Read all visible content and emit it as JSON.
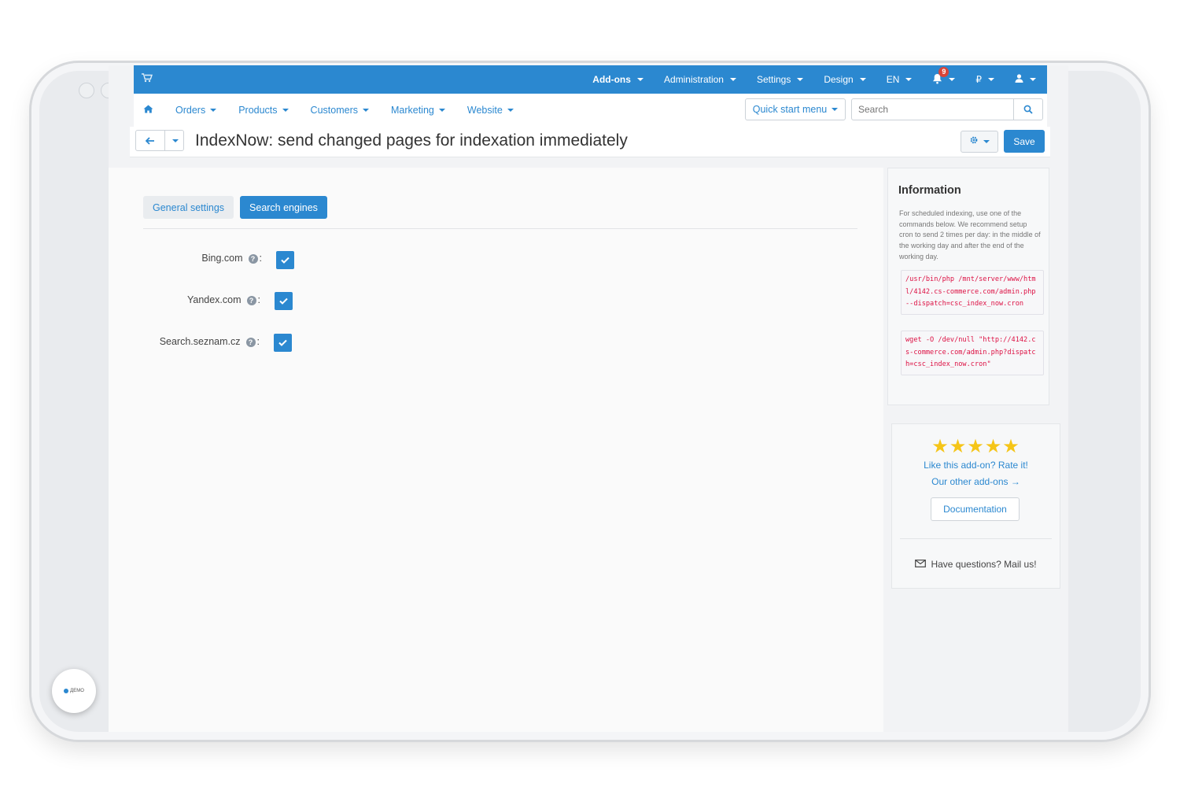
{
  "topbar": {
    "items": [
      "Add-ons",
      "Administration",
      "Settings",
      "Design",
      "EN"
    ],
    "notifications_count": "9",
    "currency": "₽"
  },
  "subnav": {
    "items": [
      "Orders",
      "Products",
      "Customers",
      "Marketing",
      "Website"
    ],
    "quick_start": "Quick start menu",
    "search_placeholder": "Search"
  },
  "page": {
    "title": "IndexNow: send changed pages for indexation immediately",
    "save_label": "Save"
  },
  "tabs": [
    {
      "label": "General settings",
      "active": false
    },
    {
      "label": "Search engines",
      "active": true
    }
  ],
  "search_engines": [
    {
      "label": "Bing.com",
      "checked": true
    },
    {
      "label": "Yandex.com",
      "checked": true
    },
    {
      "label": "Search.seznam.cz",
      "checked": true
    }
  ],
  "info": {
    "title": "Information",
    "text": "For scheduled indexing, use one of the commands below. We recommend setup cron to send 2 times per day: in the middle of the working day and after the end of the working day.",
    "command1": "/usr/bin/php /mnt/server/www/html/4142.cs-commerce.com/admin.php --dispatch=csc_index_now.cron",
    "command2": "wget -O /dev/null \"http://4142.cs-commerce.com/admin.php?dispatch=csc_index_now.cron\""
  },
  "rating": {
    "stars": "★★★★★",
    "rate_link": "Like this add-on? Rate it!",
    "other_link": "Our other add-ons →",
    "documentation": "Documentation",
    "mail": "Have questions? Mail us!"
  },
  "demo_logo": "ДЕМО",
  "colors": {
    "accent": "#2b88d0",
    "code": "#dd1144",
    "star": "#f5c518"
  }
}
